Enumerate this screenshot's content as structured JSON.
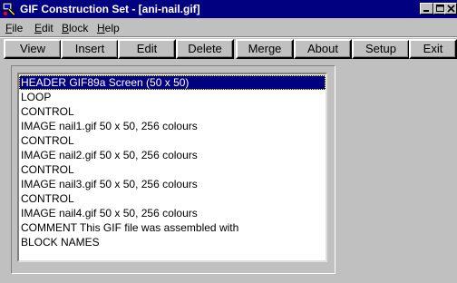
{
  "window": {
    "title": "GIF Construction Set - [ani-nail.gif]"
  },
  "menu": [
    {
      "label": "File",
      "mnemonic": "F",
      "rest": "ile"
    },
    {
      "label": "Edit",
      "mnemonic": "E",
      "rest": "dit"
    },
    {
      "label": "Block",
      "mnemonic": "B",
      "rest": "lock"
    },
    {
      "label": "Help",
      "mnemonic": "H",
      "rest": "elp"
    }
  ],
  "toolbar": {
    "view": "View",
    "insert": "Insert",
    "edit": "Edit",
    "delete": "Delete",
    "merge": "Merge",
    "about": "About",
    "setup": "Setup",
    "exit": "Exit"
  },
  "blocks": [
    {
      "text": "HEADER GIF89a Screen (50 x 50)",
      "selected": true
    },
    {
      "text": "LOOP",
      "selected": false
    },
    {
      "text": "CONTROL",
      "selected": false
    },
    {
      "text": "IMAGE nail1.gif 50 x 50, 256 colours",
      "selected": false
    },
    {
      "text": "CONTROL",
      "selected": false
    },
    {
      "text": "IMAGE nail2.gif 50 x 50, 256 colours",
      "selected": false
    },
    {
      "text": "CONTROL",
      "selected": false
    },
    {
      "text": "IMAGE nail3.gif 50 x 50, 256 colours",
      "selected": false
    },
    {
      "text": "CONTROL",
      "selected": false
    },
    {
      "text": "IMAGE nail4.gif 50 x 50, 256 colours",
      "selected": false
    },
    {
      "text": "COMMENT This GIF file was assembled with",
      "selected": false
    },
    {
      "text": "BLOCK NAMES",
      "selected": false
    }
  ],
  "colors": {
    "title_bar": "#000080",
    "selection": "#000080",
    "face": "#c0c0c0"
  }
}
